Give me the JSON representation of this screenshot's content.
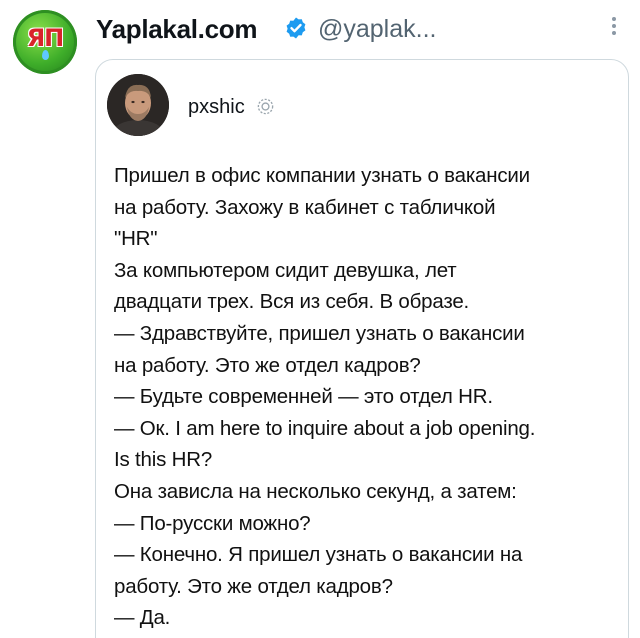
{
  "author": {
    "display_name": "Yaplakal.com",
    "handle": "@yaplak...",
    "avatar_logo": "ЯП",
    "avatar_icon": "yaplakal-logo",
    "verified_icon": "verified-badge-icon",
    "verified_color": "#1d9bf0"
  },
  "more_icon": "more-vertical-icon",
  "quoted_tweet": {
    "author_name": "pxshic",
    "avatar_icon": "user-photo-avatar",
    "badge_icon": "settings-badge-icon",
    "lines": [
      "Пришел в офис компании узнать о вакансии",
      "на работу. Захожу в кабинет с табличкой",
      "\"HR\"",
      "За компьютером сидит девушка, лет",
      "двадцати трех. Вся из себя. В образе.",
      "— Здравствуйте, пришел узнать о вакансии",
      "на работу. Это же отдел кадров?",
      "— Будьте современней —  это отдел HR.",
      "— Ок. I am here to inquire about a job opening.",
      "Is this HR?",
      "Она зависла на несколько секунд, а затем:",
      "— По-русски можно?",
      "— Конечно. Я пришел узнать о вакансии на",
      "работу. Это же отдел кадров?",
      "— Да."
    ]
  },
  "colors": {
    "text_primary": "#0f1419",
    "text_secondary": "#536471",
    "card_border": "#cfd9de",
    "logo_green": "#3fae2a",
    "logo_red": "#d8242a"
  }
}
